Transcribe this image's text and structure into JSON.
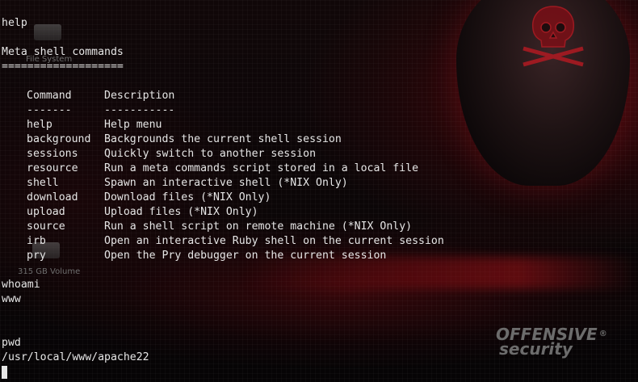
{
  "desktop": {
    "icons": [
      {
        "label": "File System"
      },
      {
        "label": "315 GB Volume"
      }
    ]
  },
  "terminal": {
    "lines": {
      "help_cmd": "help",
      "heading": "Meta shell commands",
      "underline": "===================",
      "col_command": "Command",
      "col_description": "Description",
      "col_command_rule": "-------",
      "col_description_rule": "-----------",
      "whoami_cmd": "whoami",
      "whoami_out": "www",
      "pwd_cmd": "pwd",
      "pwd_out": "/usr/local/www/apache22"
    },
    "commands": [
      {
        "name": "help",
        "description": "Help menu"
      },
      {
        "name": "background",
        "description": "Backgrounds the current shell session"
      },
      {
        "name": "sessions",
        "description": "Quickly switch to another session"
      },
      {
        "name": "resource",
        "description": "Run a meta commands script stored in a local file"
      },
      {
        "name": "shell",
        "description": "Spawn an interactive shell (*NIX Only)"
      },
      {
        "name": "download",
        "description": "Download files (*NIX Only)"
      },
      {
        "name": "upload",
        "description": "Upload files (*NIX Only)"
      },
      {
        "name": "source",
        "description": "Run a shell script on remote machine (*NIX Only)"
      },
      {
        "name": "irb",
        "description": "Open an interactive Ruby shell on the current session"
      },
      {
        "name": "pry",
        "description": "Open the Pry debugger on the current session"
      }
    ]
  },
  "logo": {
    "line1": "OFFENSIVE",
    "line2": "security",
    "mark": "®"
  },
  "colors": {
    "text": "#e6e6e6",
    "accent": "#a0141c",
    "background": "#0a0809"
  }
}
